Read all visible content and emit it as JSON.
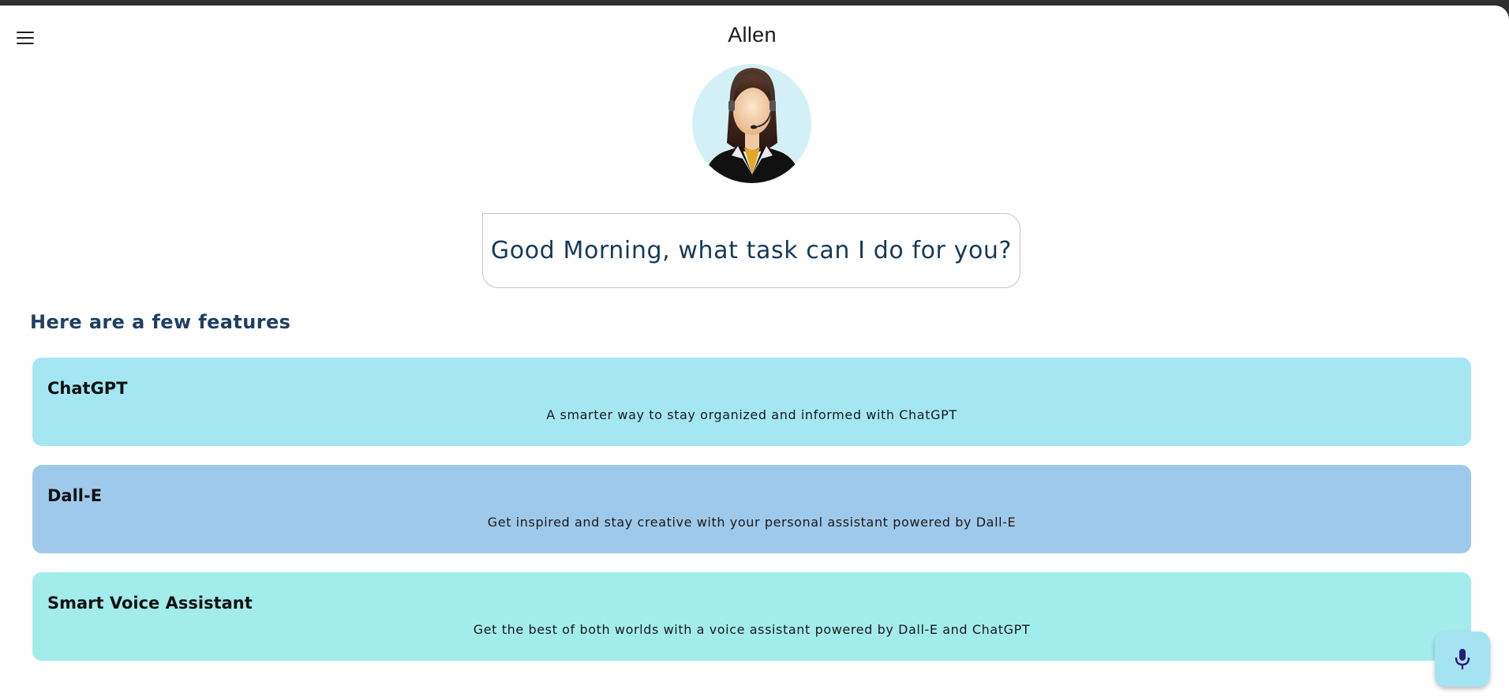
{
  "header": {
    "title": "Allen",
    "menu_icon": "hamburger-menu-icon"
  },
  "assistant": {
    "avatar_icon": "assistant-avatar-icon",
    "greeting": "Good Morning, what task can I do for you?"
  },
  "features": {
    "heading": "Here are a few features",
    "items": [
      {
        "title": "ChatGPT",
        "description": "A smarter way to stay organized and informed with ChatGPT",
        "color": "#a5e6f3"
      },
      {
        "title": "Dall-E",
        "description": "Get inspired and stay creative with your personal assistant powered by Dall-E",
        "color": "#9fc9ea"
      },
      {
        "title": "Smart Voice Assistant",
        "description": "Get the best of both worlds with a voice assistant powered by Dall-E and ChatGPT",
        "color": "#a3ecec"
      }
    ]
  },
  "fab": {
    "icon": "microphone-icon",
    "color": "#a4e4f2",
    "icon_color": "#2b1b7a"
  }
}
